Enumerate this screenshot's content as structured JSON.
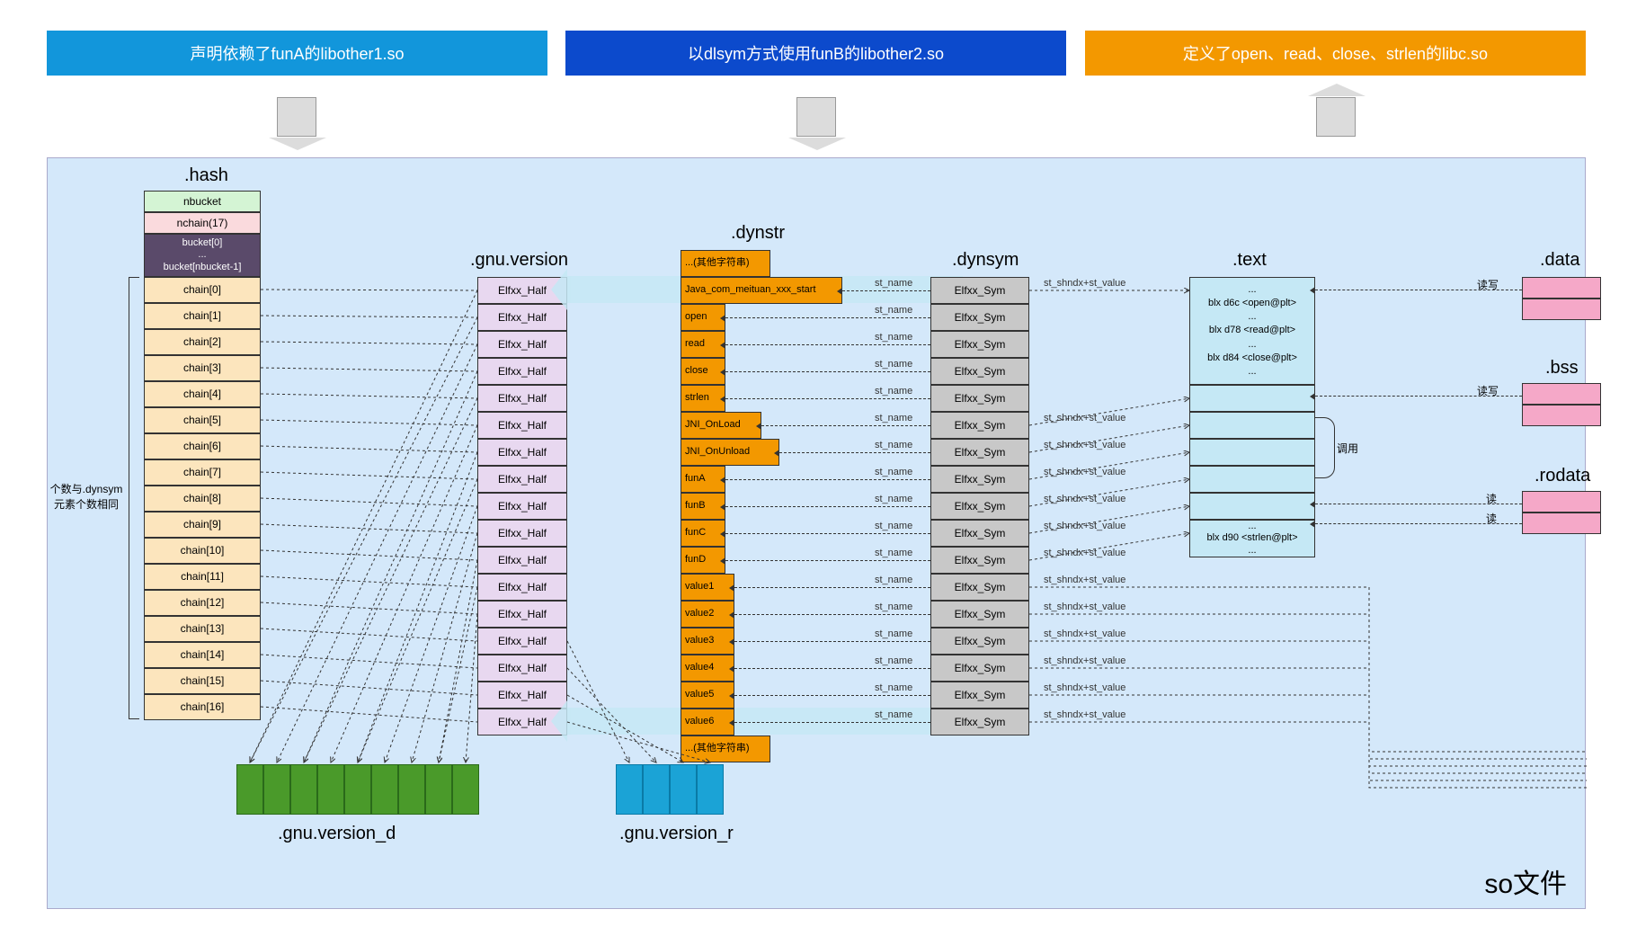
{
  "banners": {
    "a": "声明依赖了funA的libother1.so",
    "b": "以dlsym方式使用funB的libother2.so",
    "c": "定义了open、read、close、strlen的libc.so"
  },
  "so_label": "so文件",
  "side_note": "个数与.dynsym\n元素个数相同",
  "titles": {
    "hash": ".hash",
    "gnu_version": ".gnu.version",
    "dynstr": ".dynstr",
    "dynsym": ".dynsym",
    "text": ".text",
    "data": ".data",
    "bss": ".bss",
    "rodata": ".rodata",
    "gnu_version_d": ".gnu.version_d",
    "gnu_version_r": ".gnu.version_r"
  },
  "hash": {
    "nbucket": "nbucket",
    "nchain": "nchain(17)",
    "bucket": "bucket[0]\n...\nbucket[nbucket-1]",
    "chains": [
      "chain[0]",
      "chain[1]",
      "chain[2]",
      "chain[3]",
      "chain[4]",
      "chain[5]",
      "chain[6]",
      "chain[7]",
      "chain[8]",
      "chain[9]",
      "chain[10]",
      "chain[11]",
      "chain[12]",
      "chain[13]",
      "chain[14]",
      "chain[15]",
      "chain[16]"
    ]
  },
  "gnu_half": "Elfxx_Half",
  "dynstr": [
    "...(其他字符串)",
    "Java_com_meituan_xxx_start",
    "open",
    "read",
    "close",
    "strlen",
    "JNI_OnLoad",
    "JNI_OnUnload",
    "funA",
    "funB",
    "funC",
    "funD",
    "value1",
    "value2",
    "value3",
    "value4",
    "value5",
    "value6",
    "...(其他字符串)"
  ],
  "dynsym_cell": "Elfxx_Sym",
  "text_lines": [
    "...",
    "blx d6c <open@plt>",
    "...",
    "blx d78 <read@plt>",
    "...",
    "blx d84 <close@plt>",
    "..."
  ],
  "text_bottom": [
    "...",
    "blx d90 <strlen@plt>",
    "..."
  ],
  "arrow_labels": {
    "st_name": "st_name",
    "st_shndx": "st_shndx+st_value",
    "read_write": "读写",
    "read": "读",
    "call": "调用"
  }
}
